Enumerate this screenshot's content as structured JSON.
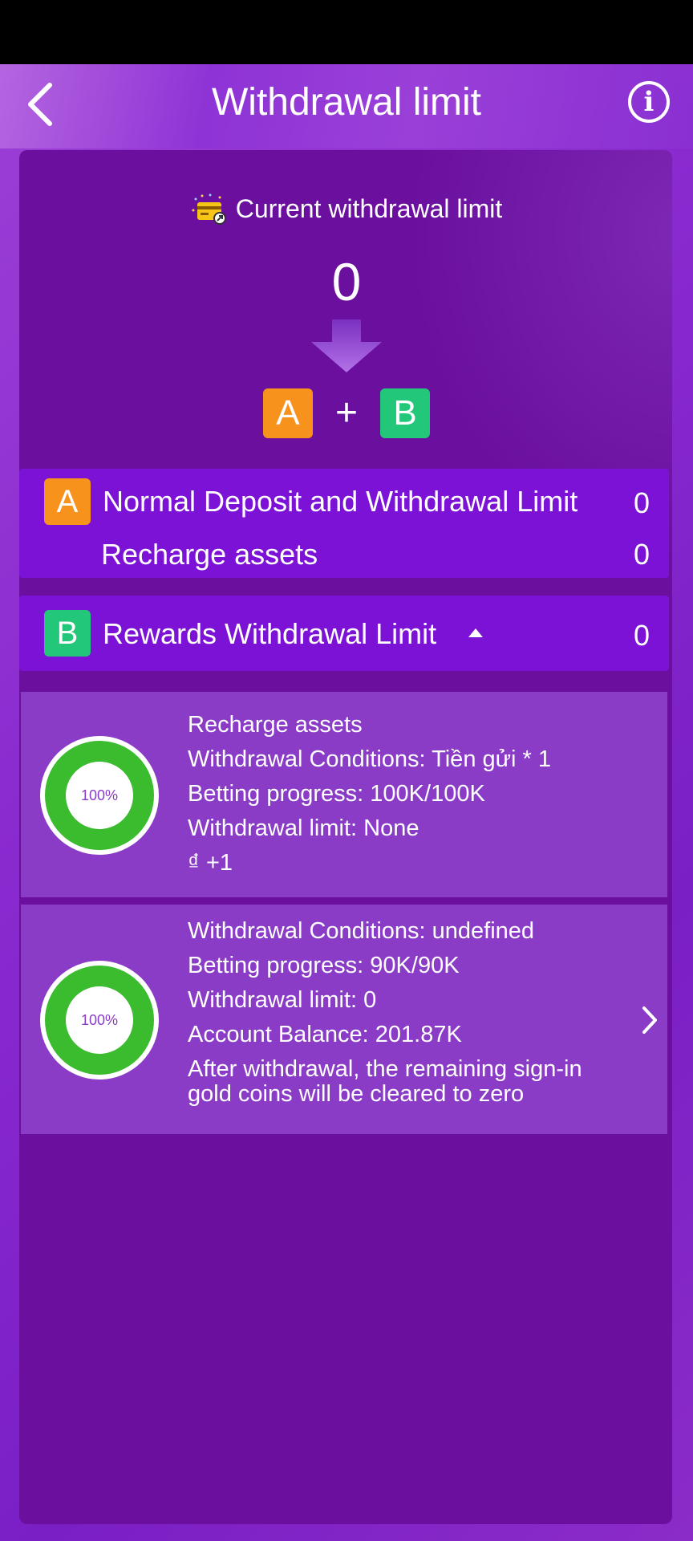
{
  "header": {
    "title": "Withdrawal limit"
  },
  "summary": {
    "title": "Current withdrawal limit",
    "value": "0",
    "badge_a": "A",
    "plus": "+",
    "badge_b": "B"
  },
  "normal_limit": {
    "badge": "A",
    "label": "Normal Deposit and Withdrawal Limit",
    "value": "0",
    "sub_label": "Recharge assets",
    "sub_value": "0"
  },
  "rewards_limit": {
    "badge": "B",
    "label": "Rewards Withdrawal Limit",
    "value": "0"
  },
  "rewards": [
    {
      "progress_percent": 100,
      "progress_label": "100%",
      "lines": [
        "Recharge assets",
        "Withdrawal Conditions:  Tiền gửi * 1",
        "Betting progress:  100K/100K",
        "Withdrawal limit:  None",
        "₫ +1"
      ]
    },
    {
      "progress_percent": 100,
      "progress_label": "100%",
      "lines": [
        "Withdrawal Conditions:  undefined",
        "Betting progress:  90K/90K",
        "Withdrawal limit:  0",
        "Account Balance:  201.87K"
      ],
      "note_lines": [
        "After withdrawal, the remaining sign-in",
        "gold coins will be cleared to zero"
      ]
    }
  ],
  "colors": {
    "panel": "#6a0f9e",
    "row_card": "#7c12d6",
    "reward_card": "#8a3cc6",
    "badge_a": "#f7921d",
    "badge_b": "#22c77a",
    "progress_ring": "#3bbb2e"
  }
}
